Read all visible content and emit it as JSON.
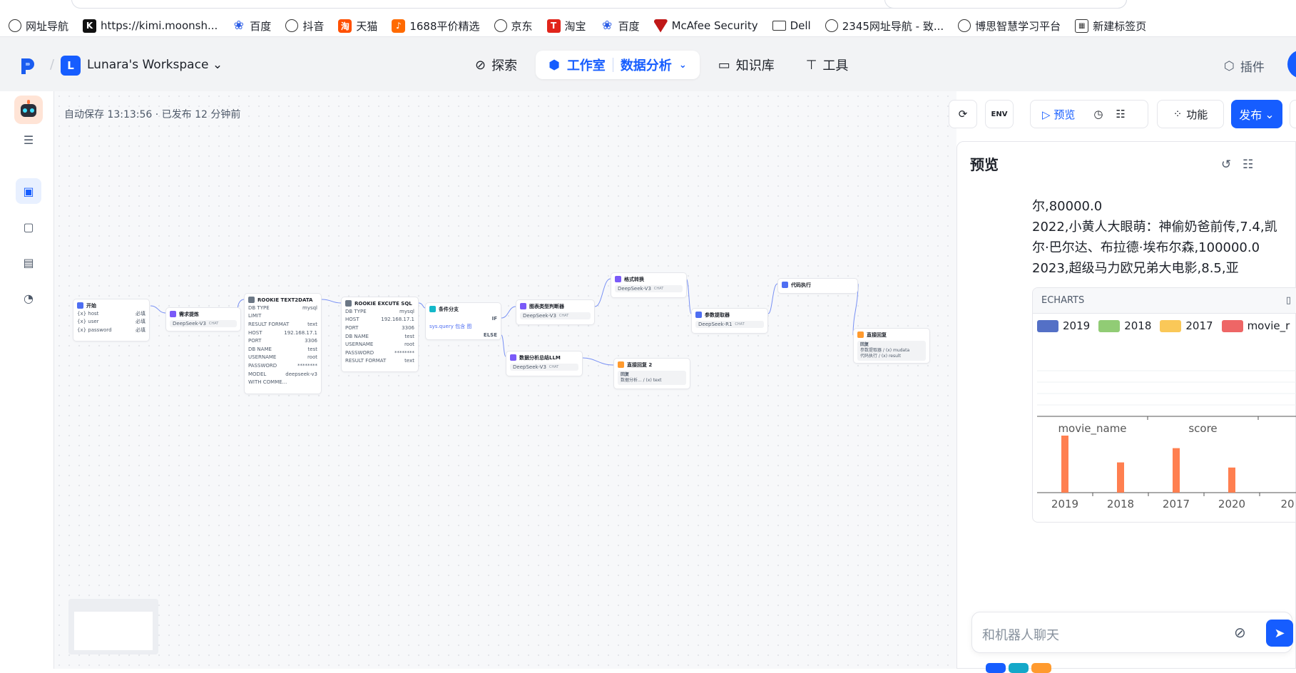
{
  "bookmarks": [
    {
      "icon": "globe",
      "label": "网址导航"
    },
    {
      "icon": "k",
      "label": "https://kimi.moonsh..."
    },
    {
      "icon": "paw",
      "label": "百度"
    },
    {
      "icon": "globe",
      "label": "抖音"
    },
    {
      "icon": "tao",
      "label": "天猫"
    },
    {
      "icon": "ali",
      "label": "1688平价精选"
    },
    {
      "icon": "globe",
      "label": "京东"
    },
    {
      "icon": "jd",
      "label": "淘宝"
    },
    {
      "icon": "paw",
      "label": "百度"
    },
    {
      "icon": "mc",
      "label": "McAfee Security"
    },
    {
      "icon": "folder",
      "label": "Dell"
    },
    {
      "icon": "globe",
      "label": "2345网址导航 - 致..."
    },
    {
      "icon": "globe",
      "label": "博思智慧学习平台"
    },
    {
      "icon": "grid",
      "label": "新建标签页"
    }
  ],
  "header": {
    "workspace_initial": "L",
    "workspace_name": "Lunara's Workspace",
    "nav": {
      "explore": "探索",
      "studio": "工作室",
      "project": "数据分析",
      "knowledge": "知识库",
      "tools": "工具"
    },
    "plugins": "插件"
  },
  "status": "自动保存 13:13:56 · 已发布 12 分钟前",
  "toolbar": {
    "env": "ENV",
    "preview": "预览",
    "features": "功能",
    "publish": "发布"
  },
  "nodes": {
    "start": {
      "title": "开始",
      "rows": [
        [
          "host",
          "必填"
        ],
        [
          "user",
          "必填"
        ],
        [
          "password",
          "必填"
        ]
      ]
    },
    "intent": {
      "title": "需求提炼",
      "model": "DeepSeek-V3",
      "tag": "CHAT"
    },
    "text2data": {
      "title": "ROOKIE TEXT2DATA",
      "rows": [
        [
          "DB TYPE",
          "mysql"
        ],
        [
          "LIMIT",
          ""
        ],
        [
          "RESULT FORMAT",
          "text"
        ],
        [
          "HOST",
          "192.168.17.1"
        ],
        [
          "PORT",
          "3306"
        ],
        [
          "DB NAME",
          "test"
        ],
        [
          "USERNAME",
          "root"
        ],
        [
          "PASSWORD",
          "********"
        ],
        [
          "MODEL",
          "deepseek-v3"
        ],
        [
          "WITH COMME...",
          ""
        ]
      ]
    },
    "sql": {
      "title": "ROOKIE EXCUTE SQL",
      "rows": [
        [
          "DB TYPE",
          "mysql"
        ],
        [
          "HOST",
          "192.168.17.1"
        ],
        [
          "PORT",
          "3306"
        ],
        [
          "DB NAME",
          "test"
        ],
        [
          "USERNAME",
          "root"
        ],
        [
          "PASSWORD",
          "********"
        ],
        [
          "RESULT FORMAT",
          "text"
        ]
      ]
    },
    "branch": {
      "title": "条件分支",
      "if": "IF",
      "cond": "sys.query 包含 图",
      "else": "ELSE"
    },
    "chart_type": {
      "title": "图表类型判断器",
      "model": "DeepSeek-V3",
      "tag": "CHAT"
    },
    "format": {
      "title": "格式转换",
      "model": "DeepSeek-V3",
      "tag": "CHAT"
    },
    "params": {
      "title": "参数提取器",
      "model": "DeepSeek-R1",
      "tag": "CHAT"
    },
    "code": {
      "title": "代码执行"
    },
    "reply": {
      "title": "直接回复",
      "label": "回复",
      "line1": "参数提取器 / (x) mudata",
      "line2": "代码执行 / (x) result"
    },
    "summary": {
      "title": "数据分析总结LLM",
      "model": "DeepSeek-V3",
      "tag": "CHAT"
    },
    "reply2": {
      "title": "直接回复 2",
      "label": "回复",
      "line1": "数据分析... / (x) text"
    }
  },
  "preview": {
    "title": "预览",
    "lines": [
      "尔,80000.0",
      "2022,小黄人大眼萌：神偷奶爸前传,7.4,凯",
      "尔·巴尔达、布拉德·埃布尔森,100000.0",
      "2023,超级马力欧兄弟大电影,8.5,亚"
    ],
    "echarts_label": "ECHARTS",
    "legend": [
      {
        "name": "2019",
        "color": "#5470c6"
      },
      {
        "name": "2018",
        "color": "#91cc75"
      },
      {
        "name": "2017",
        "color": "#fac858"
      },
      {
        "name": "movie_r",
        "color": "#ee6666"
      }
    ],
    "chat_placeholder": "和机器人聊天"
  },
  "chart_data": {
    "type": "bar",
    "title": "",
    "upper": {
      "categories": [
        "movie_name",
        "score"
      ]
    },
    "lower": {
      "categories": [
        "2019",
        "2018",
        "2017",
        "2020",
        "20"
      ],
      "values": [
        100,
        53,
        78,
        44,
        0
      ],
      "color": "#ff7f50"
    }
  }
}
